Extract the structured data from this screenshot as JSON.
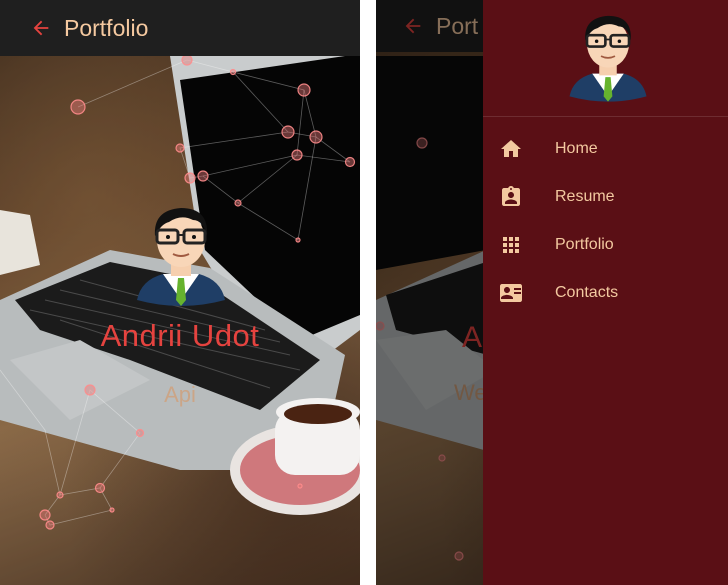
{
  "left_screen": {
    "app_title": "Portfolio",
    "hero_name": "Andrii Udot",
    "hero_subtitle": "Api"
  },
  "right_screen": {
    "app_title_partial": "Port",
    "peek_name_initial": "A",
    "peek_subtitle": "We",
    "drawer": {
      "items": [
        {
          "label": "Home",
          "icon": "home-icon"
        },
        {
          "label": "Resume",
          "icon": "badge-icon"
        },
        {
          "label": "Portfolio",
          "icon": "grid-icon"
        },
        {
          "label": "Contacts",
          "icon": "contact-card-icon"
        }
      ]
    }
  },
  "colors": {
    "appbar": "#1f1f1f",
    "title_text": "#f5c9a0",
    "accent_red": "#e5433f",
    "drawer_bg": "#5a0f15",
    "drawer_text": "#f3c9a0"
  }
}
